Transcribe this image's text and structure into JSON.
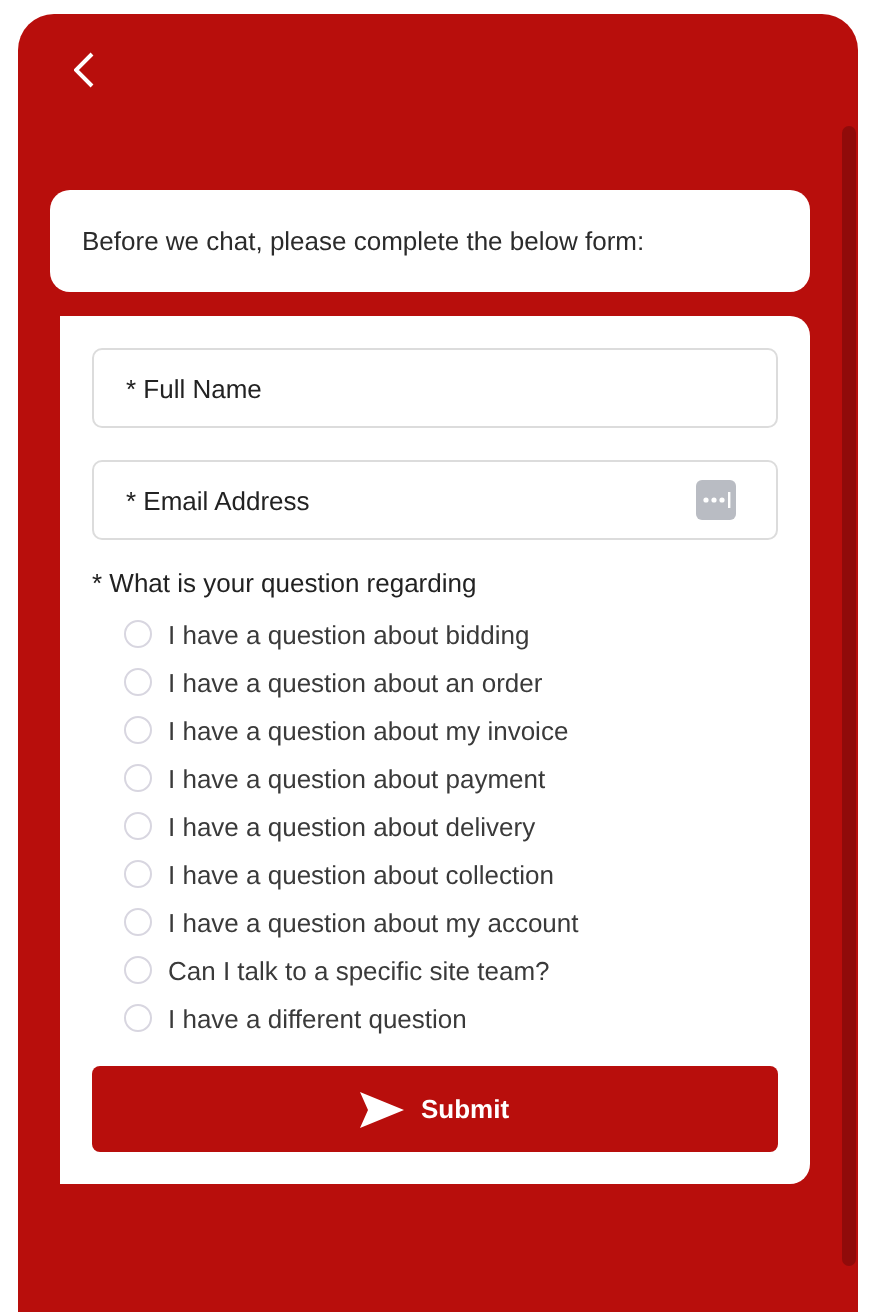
{
  "intro": "Before we chat, please complete the below form:",
  "fields": [
    {
      "placeholder": "* Full Name",
      "kind": "text"
    },
    {
      "placeholder": "* Email Address",
      "kind": "email"
    }
  ],
  "question": {
    "label": "* What is your question regarding",
    "options": [
      {
        "label": "I have a question about bidding",
        "selected": false
      },
      {
        "label": "I have a question about an order",
        "selected": false
      },
      {
        "label": "I have a question about my invoice",
        "selected": false
      },
      {
        "label": "I have a question about payment",
        "selected": false
      },
      {
        "label": "I have a question about delivery",
        "selected": false
      },
      {
        "label": "I have a question about collection",
        "selected": false
      },
      {
        "label": "I have a question about my account",
        "selected": false
      },
      {
        "label": "Can I talk to a specific site team?",
        "selected": false
      },
      {
        "label": "I have a different question",
        "selected": false
      }
    ]
  },
  "submit": "Submit"
}
